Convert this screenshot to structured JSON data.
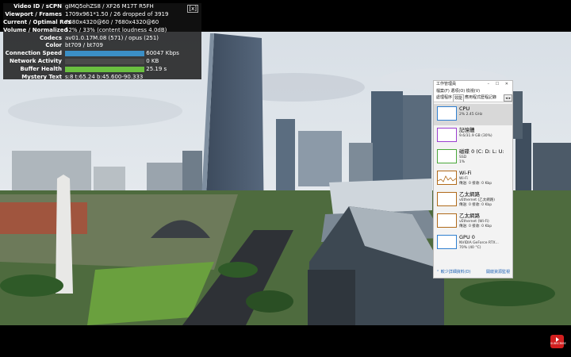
{
  "stats": {
    "close_label": "[x]",
    "rows": [
      {
        "k": "Video ID / sCPN",
        "v": "gIMQ5ohZS8 / XF26 M17T R5FH"
      },
      {
        "k": "Viewport / Frames",
        "v": "1709x961*1.50 / 26 dropped of 3919"
      },
      {
        "k": "Current / Optimal Res",
        "v": "7680x4320@60 / 7680x4320@60"
      },
      {
        "k": "Volume / Normalized",
        "v": "52% / 33% (content loudness 4.0dB)"
      },
      {
        "k": "Codecs",
        "v": "av01.0.17M.08 (571) / opus (251)"
      },
      {
        "k": "Color",
        "v": "bt709 / bt709"
      },
      {
        "k": "Connection Speed",
        "v": "60047 Kbps"
      },
      {
        "k": "Network Activity",
        "v": "0 KB"
      },
      {
        "k": "Buffer Health",
        "v": "25.19 s"
      },
      {
        "k": "Mystery Text",
        "v": "s:8 t:65.24 b:45.600-90.333"
      }
    ],
    "bar_colors": {
      "speed": "#3b8fc6",
      "network": "#e0a040",
      "buffer": "#6abf40"
    }
  },
  "task_manager": {
    "title": "工作管理員",
    "menu": "檔案(F)  選項(O)  檢視(V)",
    "tabs": [
      "處理程序",
      "效能",
      "應用程式歷程記錄"
    ],
    "active_tab": 1,
    "tab_arrows": "◂ ▸",
    "window_buttons": "– ☐ ✕",
    "items": [
      {
        "name": "CPU",
        "sub": "2% 2.45 GHz",
        "sub2": "",
        "color": "#2f7fd0",
        "selected": true
      },
      {
        "name": "記憶體",
        "sub": "9.6/31.9 GB (30%)",
        "sub2": "",
        "color": "#9b3fd0",
        "selected": false
      },
      {
        "name": "磁碟 0 (C: D: L: U:",
        "sub": "SSD",
        "sub2": "1%",
        "color": "#4aa83a",
        "selected": false
      },
      {
        "name": "Wi-Fi",
        "sub": "Wi-Fi",
        "sub2": "傳送: 0 接收: 0 Kbp",
        "color": "#b06a1a",
        "selected": false
      },
      {
        "name": "乙太網路",
        "sub": "vEthernet (乙太網路)",
        "sub2": "傳送: 0 接收: 0 Kbp",
        "color": "#b06a1a",
        "selected": false
      },
      {
        "name": "乙太網路",
        "sub": "vEthernet (Wi-Fi)",
        "sub2": "傳送: 0 接收: 0 Kbp",
        "color": "#b06a1a",
        "selected": false
      },
      {
        "name": "GPU 0",
        "sub": "NVIDIA GeForce RTX...",
        "sub2": "70% (40 °C)",
        "color": "#2f7fd0",
        "selected": false
      }
    ],
    "footer_left": "⌃ 較少詳細資料(D)",
    "footer_right": "開啟資源監視"
  },
  "youtube_badge": "SUBSCRIBE"
}
